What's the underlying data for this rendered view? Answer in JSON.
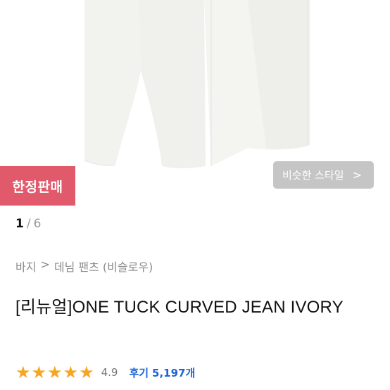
{
  "badge": {
    "label": "한정판매"
  },
  "similar_style": {
    "label": "비슷한 스타일",
    "chevron_icon": "chevron-right-icon"
  },
  "pager": {
    "current": "1",
    "separator": "/",
    "total": "6"
  },
  "breadcrumb": {
    "category": "바지",
    "separator": ">",
    "subcategory": "데님 팬츠 (비슬로우)"
  },
  "product": {
    "title": "[리뉴얼]ONE TUCK CURVED JEAN IVORY",
    "rating": "4.9",
    "star_count": 5,
    "review_label": "후기",
    "review_count": "5,197개"
  },
  "colors": {
    "badge": "#e15a6c",
    "star": "#f5a623",
    "link": "#1a64d6"
  }
}
